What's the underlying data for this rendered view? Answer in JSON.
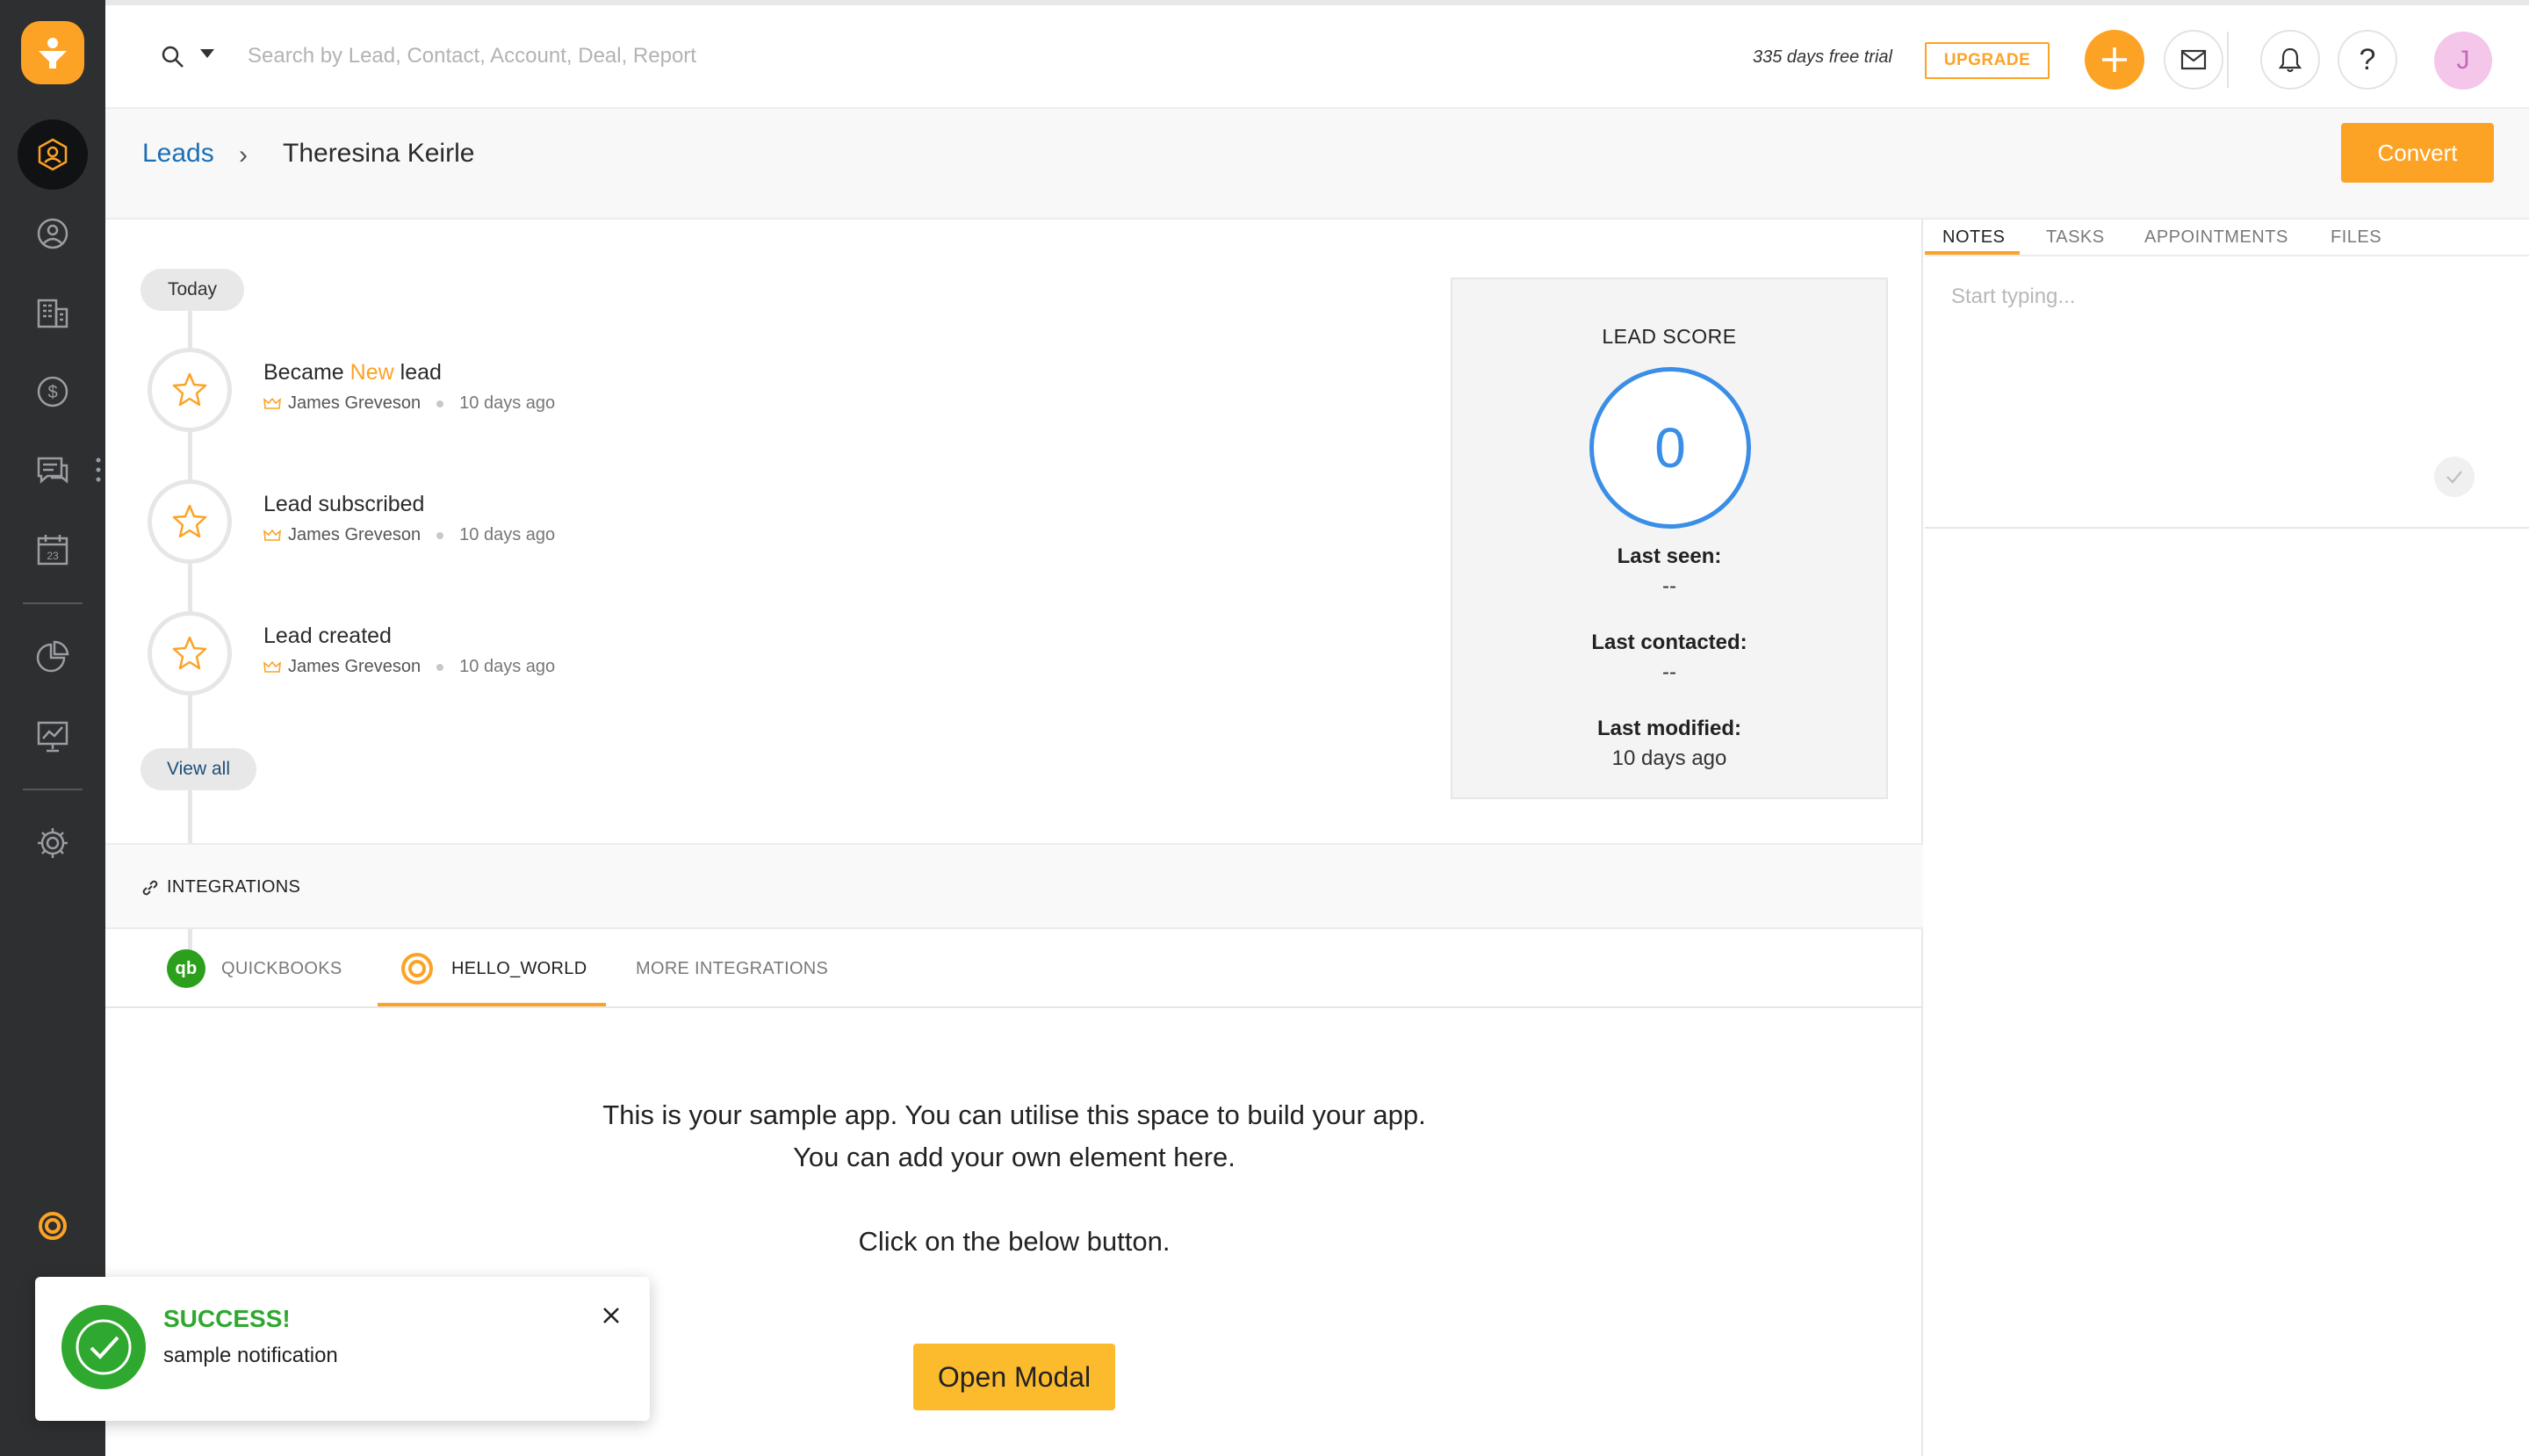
{
  "topbar": {
    "search_placeholder": "Search by Lead, Contact, Account, Deal, Report",
    "trial_text": "335 days free trial",
    "upgrade_label": "UPGRADE",
    "avatar_initial": "J"
  },
  "breadcrumb": {
    "parent": "Leads",
    "separator": "›",
    "current": "Theresina Keirle"
  },
  "header": {
    "convert_label": "Convert"
  },
  "timeline": {
    "today_label": "Today",
    "events": [
      {
        "title_prefix": "Became ",
        "title_accent": "New",
        "title_suffix": " lead",
        "user": "James Greveson",
        "ago": "10 days ago"
      },
      {
        "title_prefix": "Lead subscribed",
        "title_accent": "",
        "title_suffix": "",
        "user": "James Greveson",
        "ago": "10 days ago"
      },
      {
        "title_prefix": "Lead created",
        "title_accent": "",
        "title_suffix": "",
        "user": "James Greveson",
        "ago": "10 days ago"
      }
    ],
    "view_all_label": "View all"
  },
  "lead_score": {
    "title": "LEAD SCORE",
    "value": "0",
    "last_seen_label": "Last seen:",
    "last_seen_value": "--",
    "last_contacted_label": "Last contacted:",
    "last_contacted_value": "--",
    "last_modified_label": "Last modified:",
    "last_modified_value": "10 days ago"
  },
  "integrations": {
    "section_label": "INTEGRATIONS",
    "tabs": [
      {
        "label": "QUICKBOOKS",
        "logo_text": "qb"
      },
      {
        "label": "HELLO_WORLD"
      },
      {
        "label": "MORE INTEGRATIONS"
      }
    ],
    "active_tab": "HELLO_WORLD",
    "app_line1": "This is your sample app. You can utilise this space to build your app.",
    "app_line2": "You can add your own element here.",
    "app_line3": "Click on the below button.",
    "open_modal_label": "Open Modal"
  },
  "right_panel": {
    "tabs": [
      "NOTES",
      "TASKS",
      "APPOINTMENTS",
      "FILES"
    ],
    "active_tab": "NOTES",
    "notes_placeholder": "Start typing..."
  },
  "toast": {
    "title": "SUCCESS!",
    "message": "sample notification"
  },
  "colors": {
    "accent": "#fca326",
    "link": "#1c6fb5",
    "score_blue": "#3a8ee6",
    "success": "#2ea82e",
    "sidebar_bg": "#2d2f31"
  },
  "icons": {
    "sidebar": [
      "leads-icon",
      "contacts-icon",
      "accounts-icon",
      "deals-icon",
      "messages-icon",
      "calendar-icon",
      "reports-icon",
      "analytics-icon",
      "settings-icon",
      "hello-world-app-icon"
    ]
  }
}
